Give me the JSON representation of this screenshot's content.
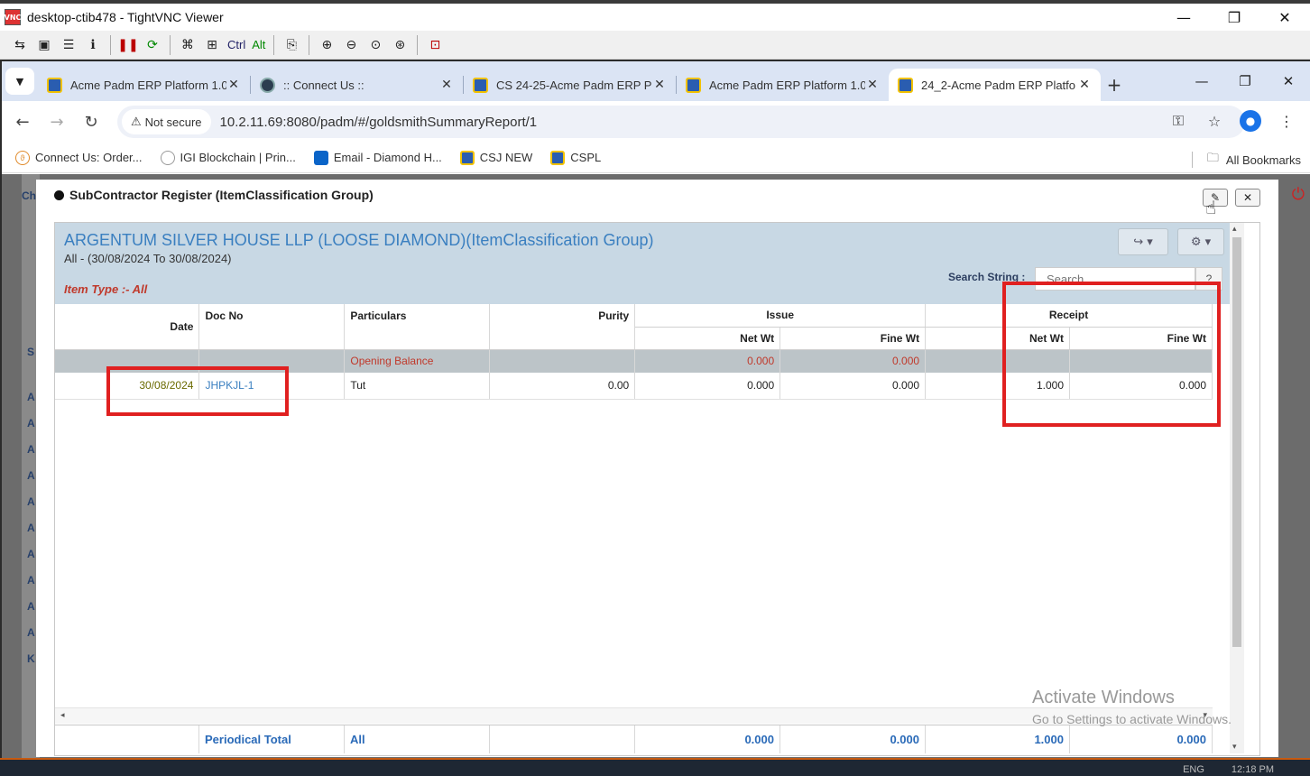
{
  "vnc": {
    "title": "desktop-ctib478 - TightVNC Viewer",
    "icon_text": "VNC",
    "toolbar": {
      "ctrl": "Ctrl",
      "alt": "Alt"
    }
  },
  "browser": {
    "tabs": [
      {
        "label": "Acme Padm ERP Platform 1.0",
        "active": false
      },
      {
        "label": ":: Connect Us ::",
        "active": false
      },
      {
        "label": "CS 24-25-Acme Padm ERP Pl",
        "active": false
      },
      {
        "label": "Acme Padm ERP Platform 1.0",
        "active": false
      },
      {
        "label": "24_2-Acme Padm ERP Platfo",
        "active": true
      }
    ],
    "not_secure": "Not secure",
    "url": "10.2.11.69:8080/padm/#/goldsmithSummaryReport/1",
    "bookmarks": [
      {
        "label": "Connect Us: Order...",
        "icon": "connect-icon"
      },
      {
        "label": "IGI Blockchain | Prin...",
        "icon": "igi-icon"
      },
      {
        "label": "Email - Diamond H...",
        "icon": "outlook-icon"
      },
      {
        "label": "CSJ NEW",
        "icon": "erp-icon"
      },
      {
        "label": "CSPL",
        "icon": "erp-icon"
      }
    ],
    "all_bookmarks": "All Bookmarks"
  },
  "background": {
    "letters": [
      "Ch",
      "S",
      "A",
      "A",
      "A",
      "A",
      "A",
      "A",
      "A",
      "A",
      "A",
      "A",
      "K"
    ]
  },
  "modal": {
    "title": "SubContractor Register (ItemClassification Group)",
    "report": {
      "title": "ARGENTUM SILVER HOUSE LLP (LOOSE DIAMOND)(ItemClassification Group)",
      "range": "All - (30/08/2024 To 30/08/2024)",
      "item_type": "Item Type :- All",
      "search_label": "Search String :",
      "search_placeholder": "Search",
      "search_help": "?",
      "columns": {
        "date": "Date",
        "doc_no": "Doc No",
        "particulars": "Particulars",
        "purity": "Purity",
        "issue": "Issue",
        "receipt": "Receipt",
        "net_wt": "Net Wt",
        "fine_wt": "Fine Wt"
      },
      "opening_balance": {
        "particulars": "Opening Balance",
        "issue_net": "0.000",
        "issue_fine": "0.000"
      },
      "rows": [
        {
          "date": "30/08/2024",
          "doc_no": "JHPKJL-1",
          "particulars": "Tut",
          "purity": "0.00",
          "issue_net": "0.000",
          "issue_fine": "0.000",
          "receipt_net": "1.000",
          "receipt_fine": "0.000"
        }
      ],
      "footer": {
        "label": "Periodical Total",
        "particulars": "All",
        "issue_net": "0.000",
        "issue_fine": "0.000",
        "receipt_net": "1.000",
        "receipt_fine": "0.000"
      }
    }
  },
  "watermark": {
    "line1": "Activate Windows",
    "line2": "Go to Settings to activate Windows."
  },
  "tray": {
    "lang": "ENG",
    "time": "12:18 PM"
  },
  "colors": {
    "highlight": "#e02020",
    "report_header": "#c8d8e4",
    "link": "#3a7fc0"
  }
}
